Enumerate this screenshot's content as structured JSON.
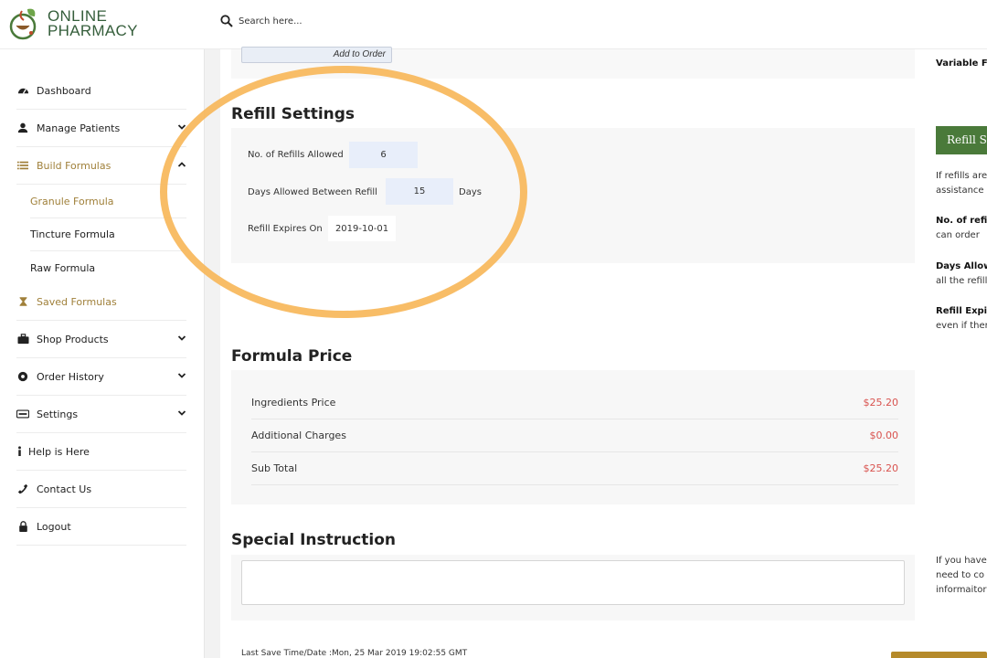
{
  "brand": {
    "line1": "ONLINE",
    "line2": "PHARMACY",
    "green": "#355e3b",
    "gold": "#a0803a"
  },
  "search": {
    "placeholder": "Search here..."
  },
  "sidebar": {
    "items": [
      {
        "label": "Dashboard",
        "icon": "dashboard-icon"
      },
      {
        "label": "Manage Patients",
        "icon": "user-icon"
      },
      {
        "label": "Build Formulas",
        "icon": "list-icon"
      },
      {
        "label": "Saved Formulas",
        "icon": "hourglass-icon"
      },
      {
        "label": "Shop Products",
        "icon": "briefcase-icon"
      },
      {
        "label": "Order History",
        "icon": "record-icon"
      },
      {
        "label": "Settings",
        "icon": "keyboard-icon"
      },
      {
        "label": "Help is Here",
        "icon": "info-icon"
      },
      {
        "label": "Contact Us",
        "icon": "phone-icon"
      },
      {
        "label": "Logout",
        "icon": "lock-icon"
      }
    ],
    "sub_items": [
      "Granule Formula",
      "Tincture Formula",
      "Raw Formula"
    ]
  },
  "top": {
    "add_to_order": "Add to Order"
  },
  "refill": {
    "title": "Refill Settings",
    "refills_label": "No. of Refills Allowed",
    "refills_value": "6",
    "days_label": "Days Allowed Between Refill",
    "days_value": "15",
    "days_unit": "Days",
    "expires_label": "Refill Expires On",
    "expires_value": "2019-10-01"
  },
  "price": {
    "title": "Formula Price",
    "rows": [
      {
        "label": "Ingredients Price",
        "amount": "$25.20"
      },
      {
        "label": "Additional Charges",
        "amount": "$0.00"
      },
      {
        "label": "Sub Total",
        "amount": "$25.20"
      }
    ],
    "amount_color": "#d9534f"
  },
  "instruction": {
    "title": "Special Instruction",
    "value": ""
  },
  "footer": {
    "last_save": "Last Save Time/Date :Mon, 25 Mar 2019 19:02:55 GMT"
  },
  "help": {
    "variable": "Variable Fo",
    "refill_button": "Refill Se",
    "p1_line1": "If refills are",
    "p1_line2": "assistance",
    "p2_title": "No. of refill",
    "p2_line": "can order",
    "p3_title": "Days Allow",
    "p3_line": "all the refill",
    "p4_title": "Refill Expiry",
    "p4_line": "even if ther",
    "p5_line1": "If you have",
    "p5_line2": "need to co",
    "p5_line3": "informaitor"
  },
  "colors": {
    "highlight": "#f7b75a",
    "button_green": "#4a7a3a",
    "save_gold": "#b58a2a"
  }
}
